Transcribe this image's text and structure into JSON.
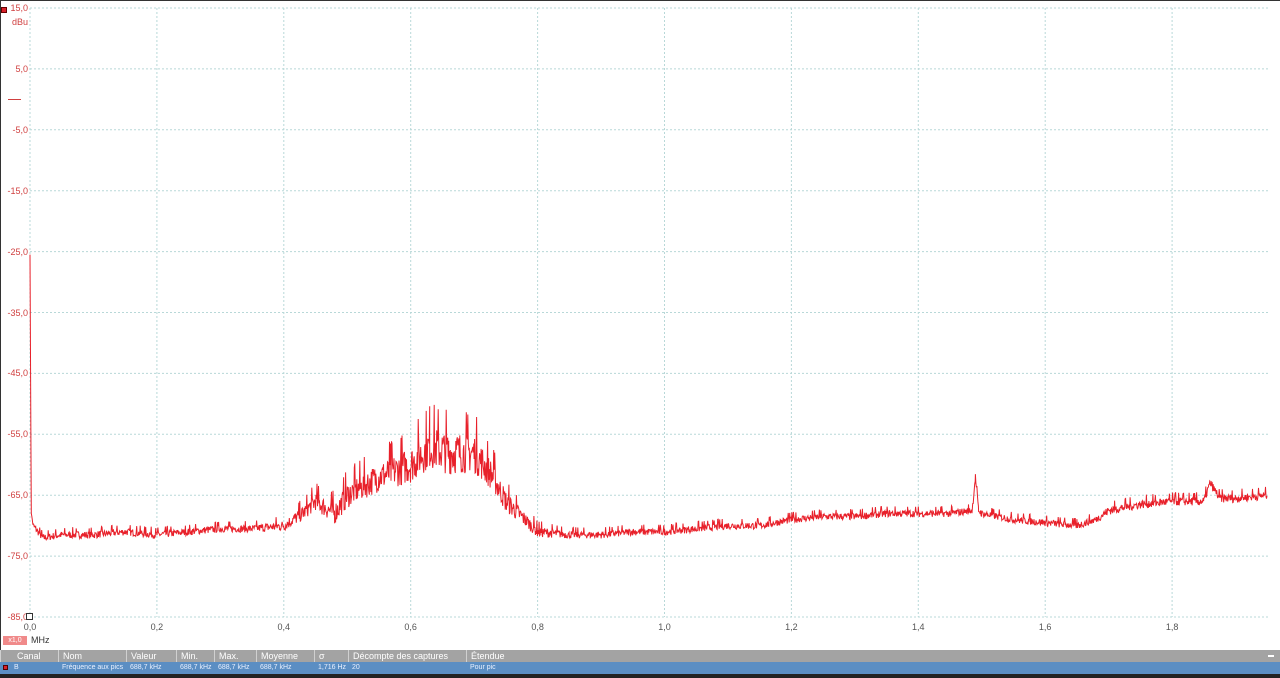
{
  "chart_data": {
    "type": "line",
    "title": "",
    "xlabel": "MHz",
    "ylabel": "dBu",
    "xlim": [
      0,
      1.95
    ],
    "ylim": [
      -85,
      15
    ],
    "grid": true,
    "x_ticks": [
      "0,0",
      "0,2",
      "0,4",
      "0,6",
      "0,8",
      "1,0",
      "1,2",
      "1,4",
      "1,6",
      "1,8"
    ],
    "x_tick_values": [
      0,
      0.2,
      0.4,
      0.6,
      0.8,
      1.0,
      1.2,
      1.4,
      1.6,
      1.8
    ],
    "y_ticks": [
      "15,0",
      "5,0",
      "-5,0",
      "-15,0",
      "-25,0",
      "-35,0",
      "-45,0",
      "-55,0",
      "-65,0",
      "-75,0",
      "-85,0"
    ],
    "y_tick_values": [
      15,
      5,
      -5,
      -15,
      -25,
      -35,
      -45,
      -55,
      -65,
      -75,
      -85
    ],
    "series": [
      {
        "name": "B",
        "color": "#e8202a",
        "x": [
          0,
          0.002,
          0.005,
          0.02,
          0.05,
          0.1,
          0.15,
          0.2,
          0.25,
          0.3,
          0.35,
          0.4,
          0.43,
          0.45,
          0.48,
          0.5,
          0.55,
          0.6,
          0.63,
          0.66,
          0.7,
          0.73,
          0.75,
          0.78,
          0.8,
          0.85,
          0.9,
          0.95,
          1.0,
          1.05,
          1.1,
          1.15,
          1.2,
          1.25,
          1.3,
          1.35,
          1.4,
          1.45,
          1.485,
          1.49,
          1.495,
          1.5,
          1.55,
          1.6,
          1.65,
          1.68,
          1.7,
          1.75,
          1.8,
          1.85,
          1.86,
          1.875,
          1.9,
          1.95
        ],
        "y": [
          -25.5,
          -68,
          -70,
          -72,
          -71.5,
          -71.5,
          -71,
          -71.5,
          -71,
          -70.5,
          -70.5,
          -70,
          -68,
          -66,
          -68,
          -65,
          -62,
          -60,
          -57,
          -58,
          -58,
          -62,
          -66,
          -69,
          -71,
          -71.5,
          -71.5,
          -71,
          -71,
          -70.5,
          -70,
          -70,
          -69,
          -68.5,
          -68.5,
          -68,
          -68,
          -68,
          -67.5,
          -62,
          -67.5,
          -68,
          -69,
          -69.5,
          -70,
          -69,
          -67.5,
          -66.5,
          -66,
          -66,
          -63,
          -65.5,
          -65.5,
          -65
        ],
        "noise": [
          0,
          0,
          1,
          1,
          1,
          1,
          1,
          1,
          1,
          1,
          1,
          1.5,
          2,
          2.5,
          3,
          3.5,
          4,
          5,
          6,
          6,
          5.5,
          4,
          3,
          2,
          1.5,
          1,
          1,
          1,
          1,
          1,
          1,
          1,
          1,
          1,
          1,
          1,
          1,
          1,
          1,
          1,
          1,
          1,
          1,
          1,
          1,
          1,
          1.2,
          1.2,
          1.2,
          1.2,
          1.2,
          1.2,
          1.2,
          1.2
        ]
      }
    ]
  },
  "axis": {
    "y_unit": "dBu",
    "x_unit": "MHz",
    "scale_badge": "x1,0"
  },
  "table": {
    "headers": [
      "Canal",
      "Nom",
      "Valeur",
      "Min.",
      "Max.",
      "Moyenne",
      "σ",
      "Décompte des captures",
      "Étendue"
    ],
    "rows": [
      [
        "B",
        "Fréquence aux pics",
        "688,7 kHz",
        "688,7 kHz",
        "688,7 kHz",
        "688,7 kHz",
        "1,716 Hz",
        "20",
        "Pour pic"
      ]
    ]
  }
}
